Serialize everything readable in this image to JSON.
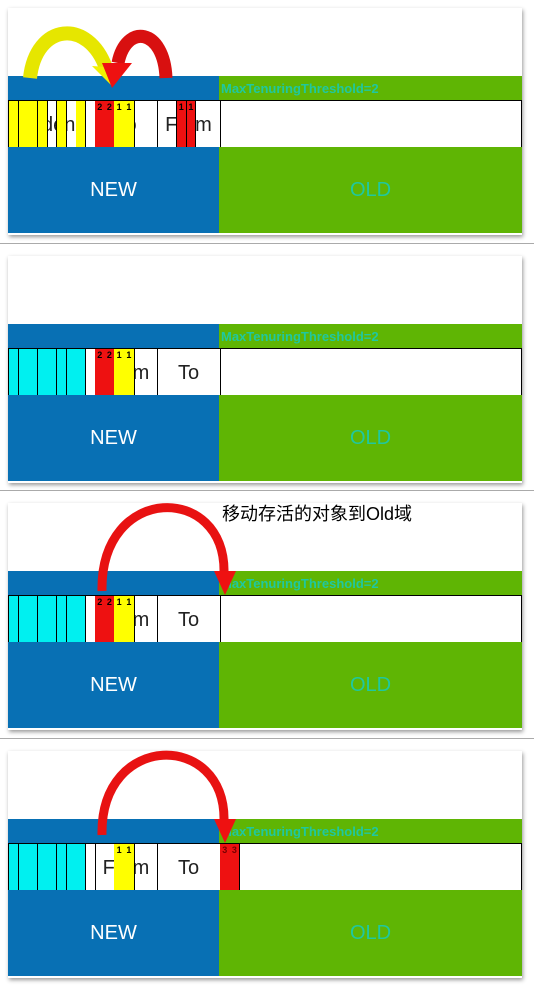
{
  "threshold_label": "MaxTenuringThreshold=2",
  "caption": "移动存活的对象到Old域",
  "regions": {
    "new": "NEW",
    "old": "OLD",
    "eden": "Eden",
    "from": "From",
    "to": "To"
  },
  "colors": {
    "new": "#0870b4",
    "old": "#5fb504",
    "yellow": "#ffff00",
    "red": "#ee1111",
    "cyan": "#00f0f0"
  },
  "panels": [
    {
      "survivor1": "To",
      "survivor2": "From",
      "eden": [
        "yellow",
        "yellow",
        "yellow",
        "yellow",
        "white",
        "yellow",
        "white",
        "yellow",
        "white"
      ],
      "s1": [
        {
          "c": "red",
          "t": "2"
        },
        {
          "c": "red",
          "t": "2"
        },
        {
          "c": "yellow",
          "t": "1"
        },
        {
          "c": "yellow",
          "t": "1"
        }
      ],
      "s2": [
        {
          "c": "red",
          "t": "1"
        },
        {
          "c": "red",
          "t": "1"
        }
      ],
      "old": [],
      "arrows": [
        "yellow-eden-to-survivor",
        "red-from-to-survivor"
      ]
    },
    {
      "survivor1": "From",
      "survivor2": "To",
      "eden": [
        "cyan",
        "cyan",
        "cyan",
        "cyan",
        "cyan",
        "cyan",
        "cyan",
        "cyan",
        "white"
      ],
      "s1": [
        {
          "c": "red",
          "t": "2"
        },
        {
          "c": "red",
          "t": "2"
        },
        {
          "c": "yellow",
          "t": "1"
        },
        {
          "c": "yellow",
          "t": "1"
        }
      ],
      "s2": [],
      "old": [],
      "arrows": []
    },
    {
      "survivor1": "From",
      "survivor2": "To",
      "eden": [
        "cyan",
        "cyan",
        "cyan",
        "cyan",
        "cyan",
        "cyan",
        "cyan",
        "cyan",
        "white"
      ],
      "s1": [
        {
          "c": "red",
          "t": "2"
        },
        {
          "c": "red",
          "t": "2"
        },
        {
          "c": "yellow",
          "t": "1"
        },
        {
          "c": "yellow",
          "t": "1"
        }
      ],
      "s2": [],
      "old": [],
      "arrows": [
        "red-survivor-to-old"
      ]
    },
    {
      "survivor1": "From",
      "survivor2": "To",
      "eden": [
        "cyan",
        "cyan",
        "cyan",
        "cyan",
        "cyan",
        "cyan",
        "cyan",
        "cyan",
        "white"
      ],
      "s1": [
        {
          "c": "white",
          "t": ""
        },
        {
          "c": "white",
          "t": ""
        },
        {
          "c": "yellow",
          "t": "1"
        },
        {
          "c": "yellow",
          "t": "1"
        }
      ],
      "s2": [],
      "old": [
        {
          "c": "red",
          "t": "3"
        },
        {
          "c": "red",
          "t": "3"
        }
      ],
      "arrows": [
        "red-survivor-to-old"
      ]
    }
  ]
}
